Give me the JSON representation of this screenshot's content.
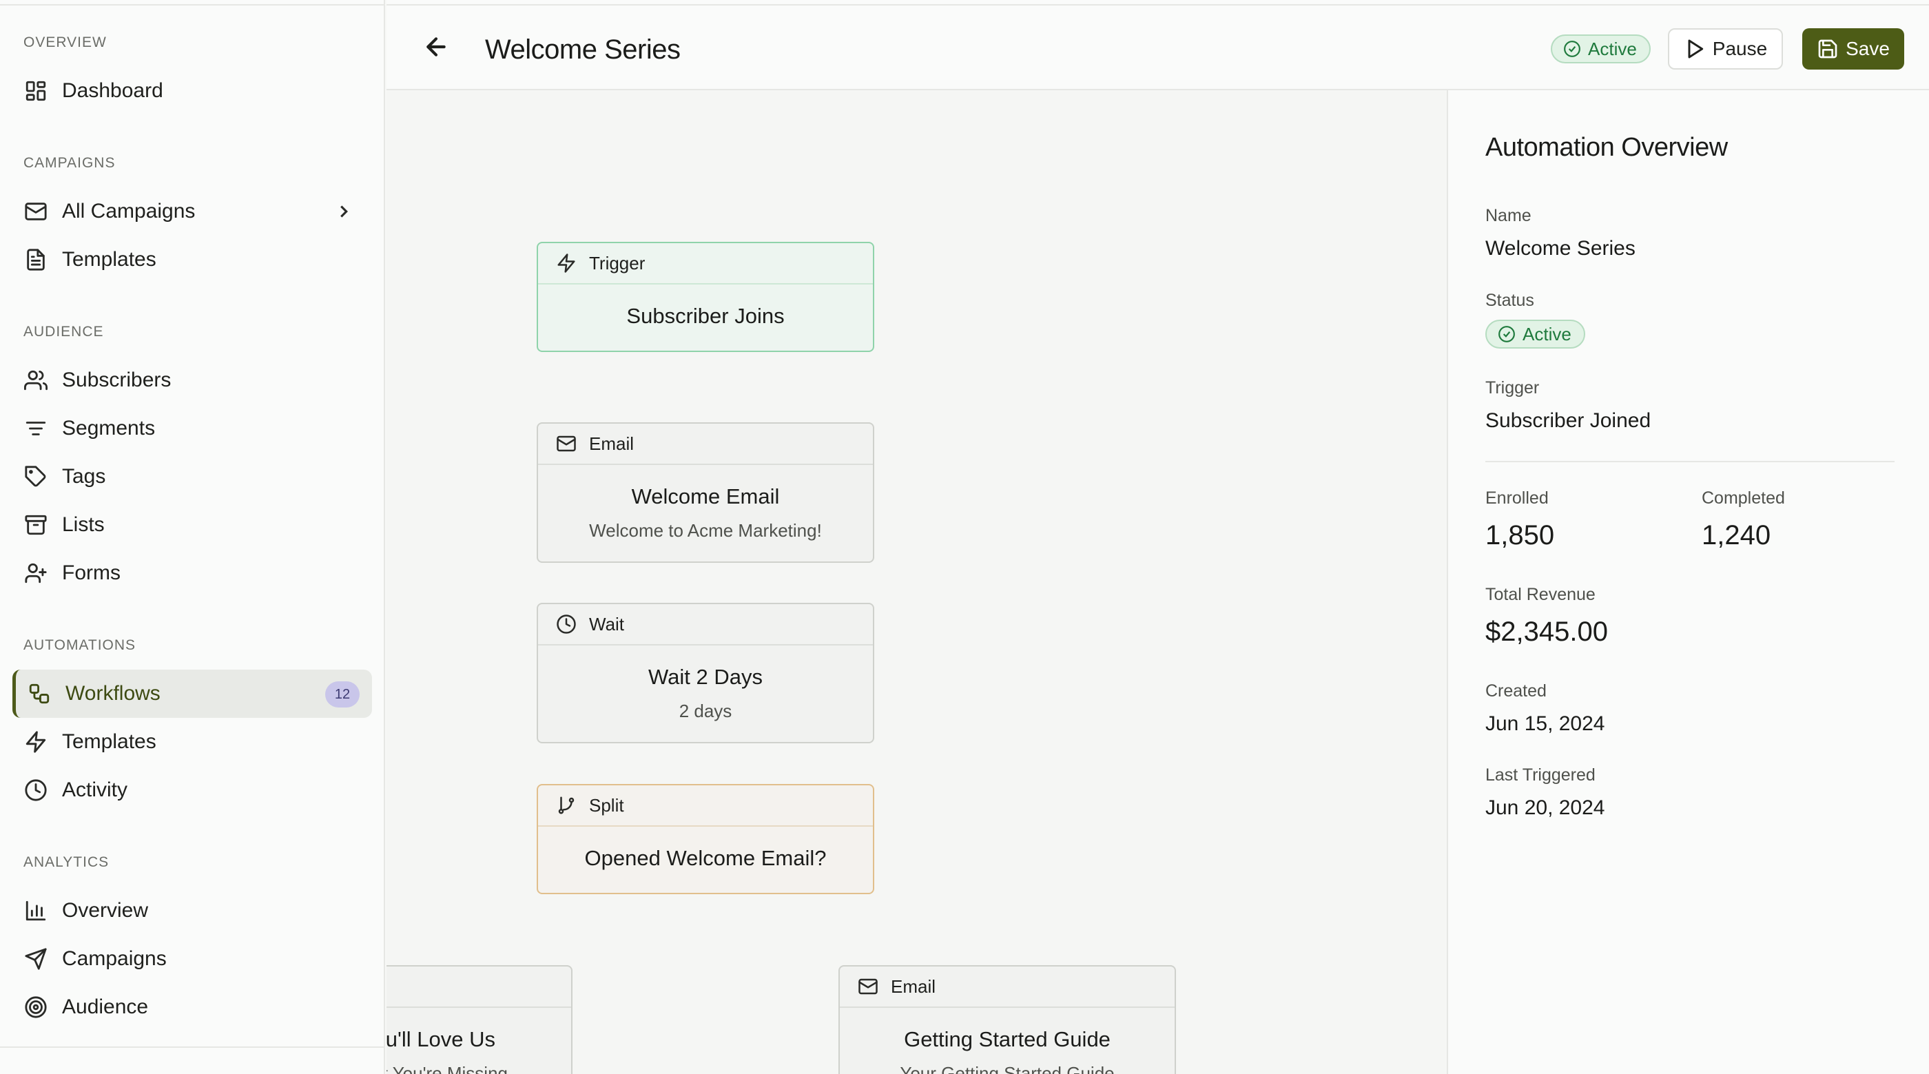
{
  "sidebar": {
    "sections": {
      "overview": "OVERVIEW",
      "campaigns": "CAMPAIGNS",
      "audience": "AUDIENCE",
      "automations": "AUTOMATIONS",
      "analytics": "ANALYTICS"
    },
    "items": {
      "dashboard": "Dashboard",
      "all_campaigns": "All Campaigns",
      "templates": "Templates",
      "subscribers": "Subscribers",
      "segments": "Segments",
      "tags": "Tags",
      "lists": "Lists",
      "forms": "Forms",
      "workflows": "Workflows",
      "workflows_count": "12",
      "auto_templates": "Templates",
      "activity": "Activity",
      "an_overview": "Overview",
      "an_campaigns": "Campaigns",
      "an_audience": "Audience"
    },
    "active_item": "Workflows"
  },
  "header": {
    "title": "Welcome Series",
    "status": "Active",
    "pause_label": "Pause",
    "save_label": "Save"
  },
  "workflow": {
    "trigger": {
      "type": "Trigger",
      "title": "Subscriber Joins"
    },
    "email1": {
      "type": "Email",
      "title": "Welcome Email",
      "subtitle": "Welcome to Acme Marketing!"
    },
    "wait": {
      "type": "Wait",
      "title": "Wait 2 Days",
      "subtitle": "2 days"
    },
    "split": {
      "type": "Split",
      "title": "Opened Welcome Email?"
    },
    "branch_left": {
      "title": "ou'll Love Us",
      "subtitle": "at You're Missing"
    },
    "branch_right": {
      "type": "Email",
      "title": "Getting Started Guide",
      "subtitle": "Your Getting Started Guide"
    }
  },
  "panel": {
    "title": "Automation Overview",
    "name_label": "Name",
    "name_value": "Welcome Series",
    "status_label": "Status",
    "status_value": "Active",
    "trigger_label": "Trigger",
    "trigger_value": "Subscriber Joined",
    "enrolled_label": "Enrolled",
    "enrolled_value": "1,850",
    "completed_label": "Completed",
    "completed_value": "1,240",
    "revenue_label": "Total Revenue",
    "revenue_value": "$2,345.00",
    "created_label": "Created",
    "created_value": "Jun 15, 2024",
    "last_label": "Last Triggered",
    "last_value": "Jun 20, 2024"
  },
  "colors": {
    "accent": "#4d5c16",
    "active_green": "#1f7a3d",
    "trigger_border": "#8fd3aa",
    "split_border": "#e1bf8c",
    "badge_bg": "#c9c6ea"
  }
}
